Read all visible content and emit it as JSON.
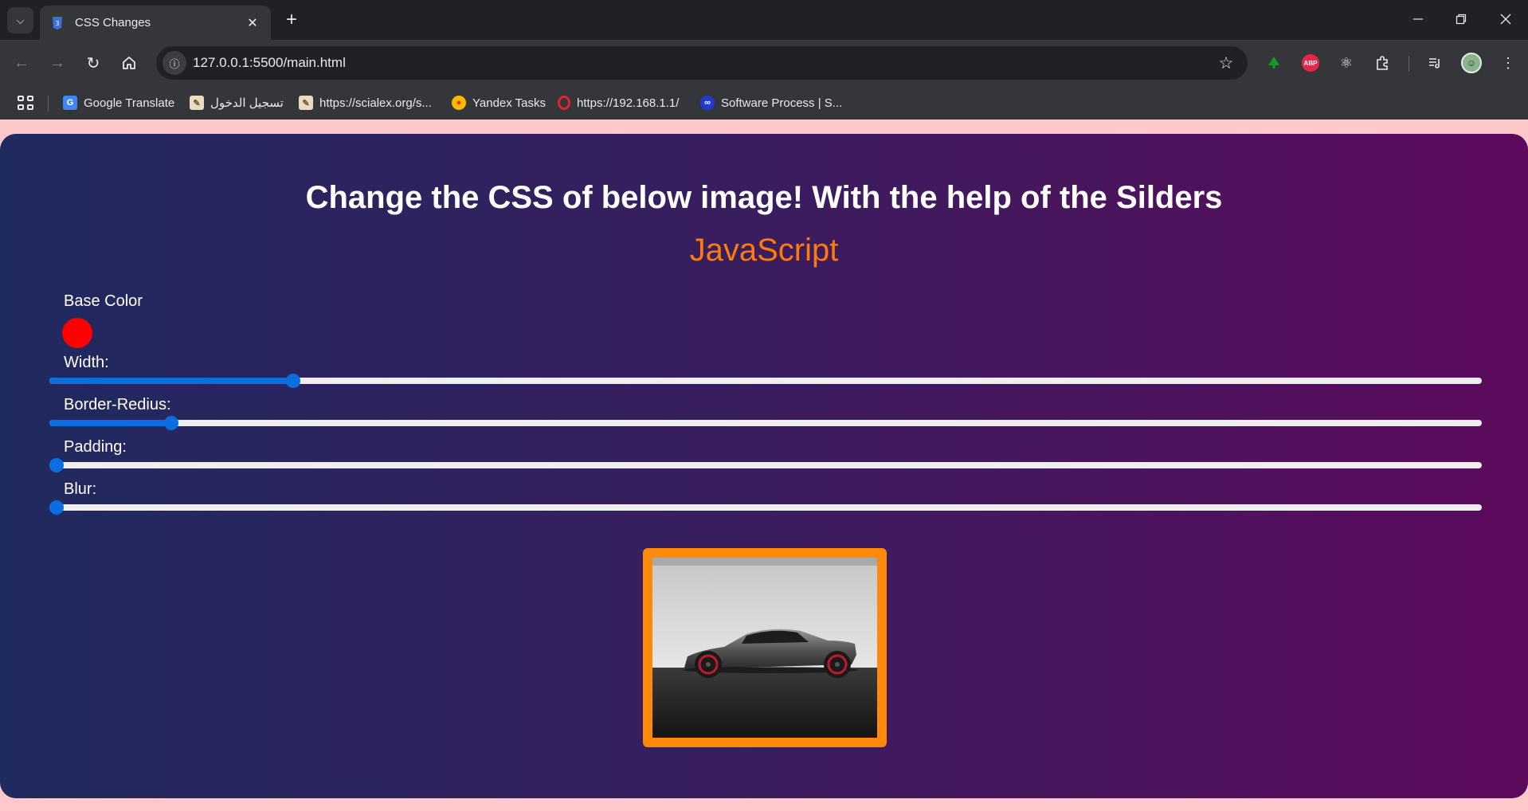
{
  "browser": {
    "tab_title": "CSS Changes",
    "url": "127.0.0.1:5500/main.html"
  },
  "bookmarks": [
    {
      "label": "Google Translate",
      "icon": "google-translate-icon",
      "color": "#4285f4"
    },
    {
      "label": "تسجيل الدخول",
      "icon": "scialex-icon",
      "color": "#c9a86a"
    },
    {
      "label": "https://scialex.org/s...",
      "icon": "scialex-icon",
      "color": "#c9a86a"
    },
    {
      "label": "Yandex Tasks",
      "icon": "yandex-icon",
      "color": "#fcb900"
    },
    {
      "label": "https://192.168.1.1/",
      "icon": "opera-icon",
      "color": "#e0242f"
    },
    {
      "label": "Software Process | S...",
      "icon": "link-icon",
      "color": "#1f3bd1"
    }
  ],
  "page": {
    "title": "Change the CSS of below image! With the help of the Silders",
    "subtitle": "JavaScript",
    "base_color_label": "Base Color",
    "base_color": "#ff0000",
    "sliders": [
      {
        "label": "Width:",
        "value": 0.17
      },
      {
        "label": "Border-Redius:",
        "value": 0.085
      },
      {
        "label": "Padding:",
        "value": 0
      },
      {
        "label": "Blur:",
        "value": 0
      }
    ]
  },
  "colors": {
    "accent": "#ff7a0d",
    "slider_active": "#0b6ee0",
    "image_border": "#ff8a0a",
    "gradient_start": "#1f2a5e",
    "gradient_end": "#5c0a5c"
  }
}
